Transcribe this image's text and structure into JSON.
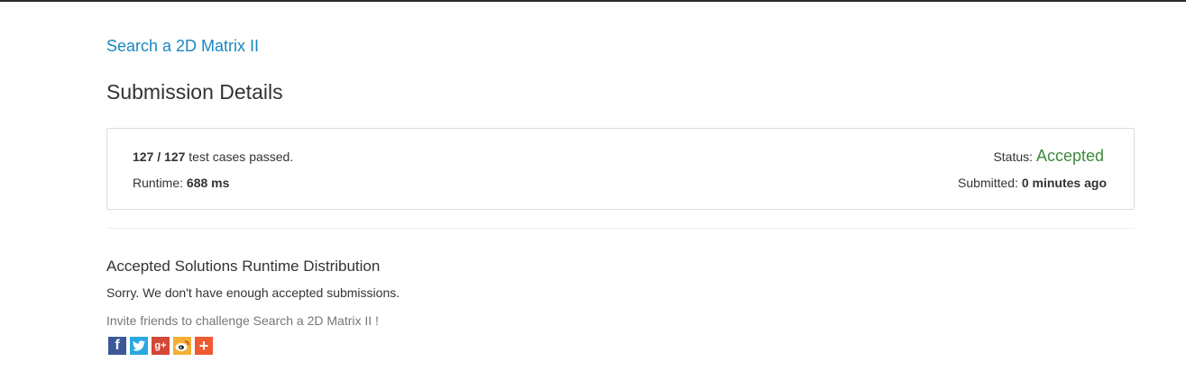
{
  "problem": {
    "title": "Search a 2D Matrix II"
  },
  "page": {
    "title": "Submission Details"
  },
  "result": {
    "passed": "127",
    "separator": "/",
    "total": "127",
    "tests_suffix": "test cases passed.",
    "runtime_label": "Runtime:",
    "runtime_value": "688 ms",
    "status_label": "Status:",
    "status_value": "Accepted",
    "submitted_label": "Submitted:",
    "submitted_value": "0 minutes ago"
  },
  "distribution": {
    "title": "Accepted Solutions Runtime Distribution",
    "sorry_text": "Sorry. We don't have enough accepted submissions.",
    "invite_text": "Invite friends to challenge Search a 2D Matrix II !"
  },
  "share": {
    "buttons": [
      {
        "icon": "facebook-icon",
        "glyph": "f"
      },
      {
        "icon": "twitter-icon",
        "glyph": "t"
      },
      {
        "icon": "google-plus-icon",
        "glyph": "g+"
      },
      {
        "icon": "weibo-icon",
        "glyph": "w"
      },
      {
        "icon": "more-share-icon",
        "glyph": "+"
      }
    ]
  },
  "colors": {
    "link": "#1a87c0",
    "accepted": "#3c8a3c",
    "facebook": "#3b5998",
    "twitter": "#2aa9e0",
    "google_plus": "#d34836",
    "weibo": "#f2b134",
    "more": "#f05a32"
  }
}
